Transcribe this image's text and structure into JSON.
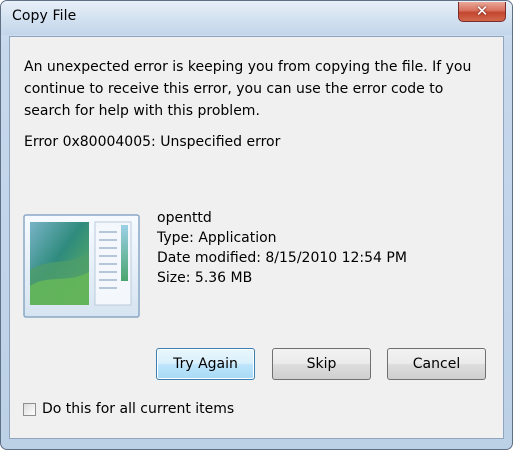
{
  "window": {
    "title": "Copy File",
    "close_symbol": "✕"
  },
  "dialog": {
    "message": "An unexpected error is keeping you from copying the file. If you continue to receive this error, you can use the error code to search for help with this problem.",
    "error": "Error 0x80004005: Unspecified error"
  },
  "file": {
    "name": "openttd",
    "type": "Type: Application",
    "date_modified": "Date modified: 8/15/2010 12:54 PM",
    "size": "Size: 5.36 MB",
    "icon": "application-window-icon"
  },
  "buttons": {
    "try_again": "Try Again",
    "skip": "Skip",
    "cancel": "Cancel"
  },
  "checkbox": {
    "label": "Do this for all current items",
    "checked": false
  },
  "colors": {
    "title_bar": "#d4e2f1",
    "close_button": "#c2462f",
    "client_background": "#f0f0f0",
    "default_button_border": "#3c7fb1"
  }
}
